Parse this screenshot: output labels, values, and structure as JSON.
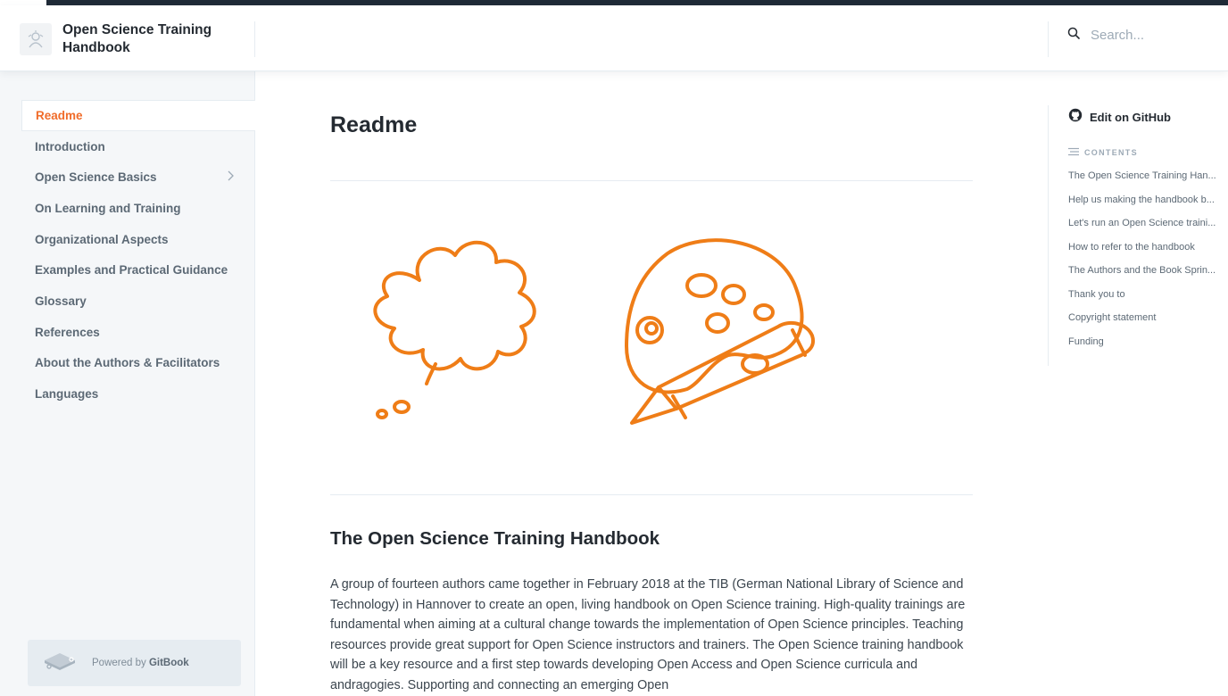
{
  "header": {
    "title": "Open Science Training Handbook",
    "search_placeholder": "Search..."
  },
  "sidebar": {
    "items": [
      {
        "label": "Readme",
        "active": true
      },
      {
        "label": "Introduction"
      },
      {
        "label": "Open Science Basics",
        "expandable": true
      },
      {
        "label": "On Learning and Training"
      },
      {
        "label": "Organizational Aspects"
      },
      {
        "label": "Examples and Practical Guidance"
      },
      {
        "label": "Glossary"
      },
      {
        "label": "References"
      },
      {
        "label": "About the Authors & Facilitators"
      },
      {
        "label": "Languages"
      }
    ],
    "powered_prefix": "Powered by ",
    "powered_brand": "GitBook"
  },
  "main": {
    "title": "Readme",
    "section_title": "The Open Science Training Handbook",
    "paragraph": "A group of fourteen authors came together in February 2018 at the TIB (German National Library of Science and Technology) in Hannover to create an open, living handbook on Open Science training. High-quality trainings are fundamental when aiming at a cultural change towards the implementation of Open Science principles. Teaching resources provide great support for Open Science instructors and trainers. The Open Science training handbook will be a key resource and a first step towards developing Open Access and Open Science curricula and andragogies. Supporting and connecting an emerging Open"
  },
  "toc": {
    "edit_label": "Edit on GitHub",
    "contents_label": "CONTENTS",
    "items": [
      "The Open Science Training Han...",
      "Help us making the handbook b...",
      "Let's run an Open Science traini...",
      "How to refer to the handbook",
      "The Authors and the Book Sprin...",
      "Thank you to",
      "Copyright statement",
      "Funding"
    ]
  },
  "colors": {
    "accent": "#f06c2a",
    "illustration": "#ef7d17",
    "sidebar_bg": "#f5f7f9",
    "text": "#242a31"
  }
}
